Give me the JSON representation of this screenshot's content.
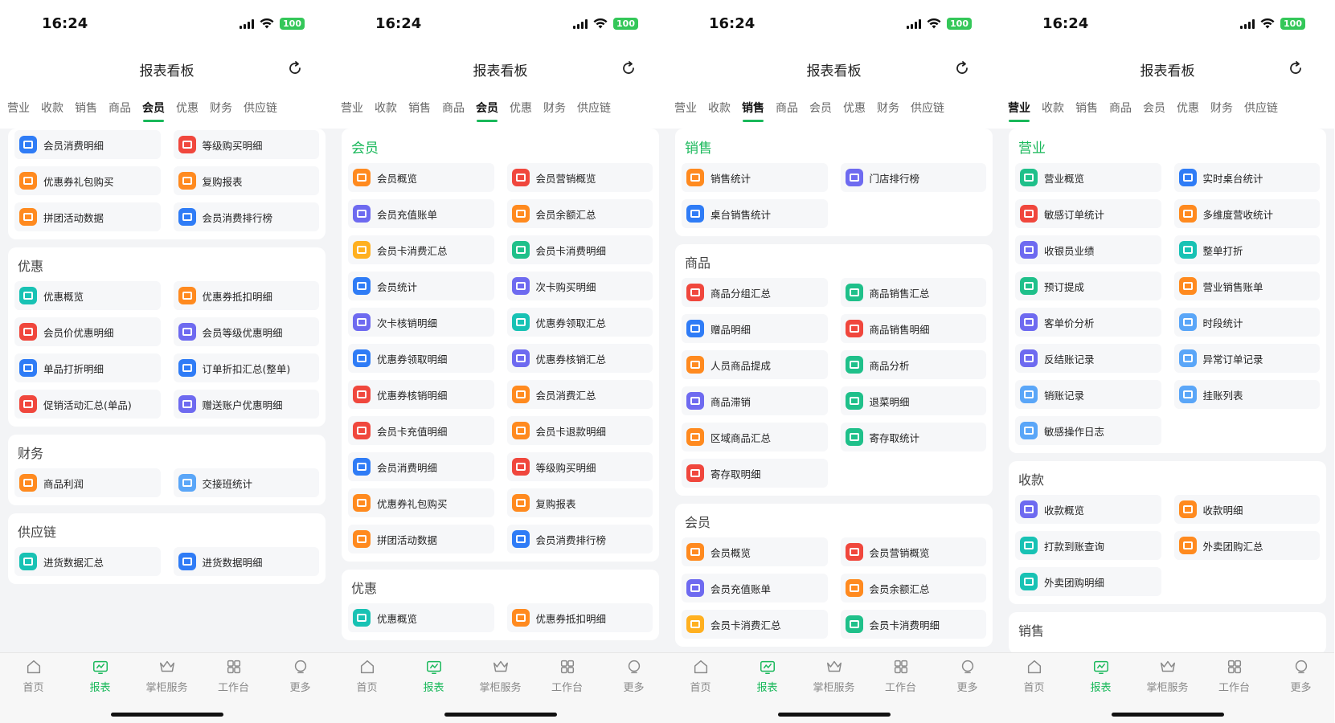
{
  "status": {
    "time": "16:24",
    "battery": "100"
  },
  "header": {
    "title": "报表看板"
  },
  "tabs": [
    "营业",
    "收款",
    "销售",
    "商品",
    "会员",
    "优惠",
    "财务",
    "供应链"
  ],
  "bottom_nav": [
    "首页",
    "报表",
    "掌柜服务",
    "工作台",
    "更多"
  ],
  "screens": [
    {
      "active_tab": 4,
      "sections": [
        {
          "title": "",
          "items": [
            {
              "label": "会员消费明细",
              "color": "blue"
            },
            {
              "label": "等级购买明细",
              "color": "red"
            },
            {
              "label": "优惠券礼包购买",
              "color": "orange"
            },
            {
              "label": "复购报表",
              "color": "orange"
            },
            {
              "label": "拼团活动数据",
              "color": "orange"
            },
            {
              "label": "会员消费排行榜",
              "color": "blue"
            }
          ]
        },
        {
          "title": "优惠",
          "items": [
            {
              "label": "优惠概览",
              "color": "teal"
            },
            {
              "label": "优惠券抵扣明细",
              "color": "orange"
            },
            {
              "label": "会员价优惠明细",
              "color": "red"
            },
            {
              "label": "会员等级优惠明细",
              "color": "purple"
            },
            {
              "label": "单品打折明细",
              "color": "blue"
            },
            {
              "label": "订单折扣汇总(整单)",
              "color": "blue"
            },
            {
              "label": "促销活动汇总(单品)",
              "color": "red"
            },
            {
              "label": "赠送账户优惠明细",
              "color": "purple"
            }
          ]
        },
        {
          "title": "财务",
          "items": [
            {
              "label": "商品利润",
              "color": "orange"
            },
            {
              "label": "交接班统计",
              "color": "sky"
            }
          ]
        },
        {
          "title": "供应链",
          "items": [
            {
              "label": "进货数据汇总",
              "color": "teal"
            },
            {
              "label": "进货数据明细",
              "color": "blue"
            }
          ]
        }
      ]
    },
    {
      "active_tab": 4,
      "sections": [
        {
          "title": "会员",
          "items": [
            {
              "label": "会员概览",
              "color": "orange"
            },
            {
              "label": "会员营销概览",
              "color": "red"
            },
            {
              "label": "会员充值账单",
              "color": "purple"
            },
            {
              "label": "会员余额汇总",
              "color": "orange"
            },
            {
              "label": "会员卡消费汇总",
              "color": "yellow"
            },
            {
              "label": "会员卡消费明细",
              "color": "green"
            },
            {
              "label": "会员统计",
              "color": "blue"
            },
            {
              "label": "次卡购买明细",
              "color": "purple"
            },
            {
              "label": "次卡核销明细",
              "color": "purple"
            },
            {
              "label": "优惠券领取汇总",
              "color": "teal"
            },
            {
              "label": "优惠券领取明细",
              "color": "blue"
            },
            {
              "label": "优惠券核销汇总",
              "color": "purple"
            },
            {
              "label": "优惠券核销明细",
              "color": "red"
            },
            {
              "label": "会员消费汇总",
              "color": "orange"
            },
            {
              "label": "会员卡充值明细",
              "color": "red"
            },
            {
              "label": "会员卡退款明细",
              "color": "orange"
            },
            {
              "label": "会员消费明细",
              "color": "blue"
            },
            {
              "label": "等级购买明细",
              "color": "red"
            },
            {
              "label": "优惠券礼包购买",
              "color": "orange"
            },
            {
              "label": "复购报表",
              "color": "orange"
            },
            {
              "label": "拼团活动数据",
              "color": "orange"
            },
            {
              "label": "会员消费排行榜",
              "color": "blue"
            }
          ]
        },
        {
          "title": "优惠",
          "items": [
            {
              "label": "优惠概览",
              "color": "teal"
            },
            {
              "label": "优惠券抵扣明细",
              "color": "orange"
            }
          ]
        }
      ]
    },
    {
      "active_tab": 2,
      "sections": [
        {
          "title": "销售",
          "items": [
            {
              "label": "销售统计",
              "color": "orange"
            },
            {
              "label": "门店排行榜",
              "color": "purple"
            },
            {
              "label": "桌台销售统计",
              "color": "blue"
            }
          ]
        },
        {
          "title": "商品",
          "items": [
            {
              "label": "商品分组汇总",
              "color": "red"
            },
            {
              "label": "商品销售汇总",
              "color": "green"
            },
            {
              "label": "赠品明细",
              "color": "blue"
            },
            {
              "label": "商品销售明细",
              "color": "red"
            },
            {
              "label": "人员商品提成",
              "color": "orange"
            },
            {
              "label": "商品分析",
              "color": "green"
            },
            {
              "label": "商品滞销",
              "color": "purple"
            },
            {
              "label": "退菜明细",
              "color": "green"
            },
            {
              "label": "区域商品汇总",
              "color": "orange"
            },
            {
              "label": "寄存取统计",
              "color": "green"
            },
            {
              "label": "寄存取明细",
              "color": "red"
            }
          ]
        },
        {
          "title": "会员",
          "items": [
            {
              "label": "会员概览",
              "color": "orange"
            },
            {
              "label": "会员营销概览",
              "color": "red"
            },
            {
              "label": "会员充值账单",
              "color": "purple"
            },
            {
              "label": "会员余额汇总",
              "color": "orange"
            },
            {
              "label": "会员卡消费汇总",
              "color": "yellow"
            },
            {
              "label": "会员卡消费明细",
              "color": "green"
            }
          ]
        }
      ]
    },
    {
      "active_tab": 0,
      "sections": [
        {
          "title": "营业",
          "items": [
            {
              "label": "营业概览",
              "color": "green"
            },
            {
              "label": "实时桌台统计",
              "color": "blue"
            },
            {
              "label": "敏感订单统计",
              "color": "red"
            },
            {
              "label": "多维度营收统计",
              "color": "orange"
            },
            {
              "label": "收银员业绩",
              "color": "purple"
            },
            {
              "label": "整单打折",
              "color": "teal"
            },
            {
              "label": "预订提成",
              "color": "green"
            },
            {
              "label": "营业销售账单",
              "color": "orange"
            },
            {
              "label": "客单价分析",
              "color": "purple"
            },
            {
              "label": "时段统计",
              "color": "sky"
            },
            {
              "label": "反结账记录",
              "color": "purple"
            },
            {
              "label": "异常订单记录",
              "color": "sky"
            },
            {
              "label": "销账记录",
              "color": "sky"
            },
            {
              "label": "挂账列表",
              "color": "sky"
            },
            {
              "label": "敏感操作日志",
              "color": "sky"
            }
          ]
        },
        {
          "title": "收款",
          "items": [
            {
              "label": "收款概览",
              "color": "purple"
            },
            {
              "label": "收款明细",
              "color": "orange"
            },
            {
              "label": "打款到账查询",
              "color": "teal"
            },
            {
              "label": "外卖团购汇总",
              "color": "orange"
            },
            {
              "label": "外卖团购明细",
              "color": "teal"
            }
          ]
        },
        {
          "title": "销售",
          "items": []
        }
      ]
    }
  ]
}
